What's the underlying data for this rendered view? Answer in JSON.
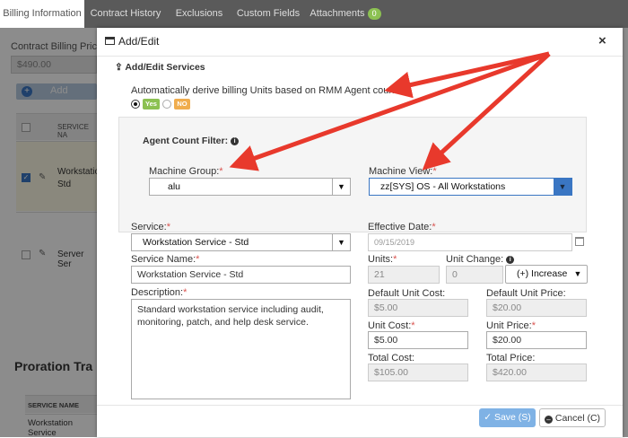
{
  "tabs": [
    {
      "label": "Billing Information"
    },
    {
      "label": "Contract History"
    },
    {
      "label": "Exclusions"
    },
    {
      "label": "Custom Fields"
    },
    {
      "label": "Attachments",
      "badge": "0"
    }
  ],
  "background": {
    "contract_billing_price_label": "Contract Billing Price:",
    "contract_billing_price_value": "$490.00",
    "add_label": "Add",
    "table_header": "SERVICE NA",
    "rows": [
      {
        "line1": "Workstatio",
        "line2": "Std",
        "checked": true
      },
      {
        "line1": "Server Ser",
        "line2": "",
        "checked": false
      }
    ],
    "proration_title": "Proration Tra",
    "proration_header": "SERVICE NAME",
    "proration_row": "Workstation Service"
  },
  "modal": {
    "title": "Add/Edit",
    "section_title": "Add/Edit Services",
    "auto_derive_label": "Automatically derive billing Units based on RMM Agent count:",
    "yes_label": "Yes",
    "no_label": "NO",
    "agent_filter_title": "Agent Count Filter:",
    "machine_group_label": "Machine Group:",
    "machine_group_value": "alu",
    "machine_view_label": "Machine View:",
    "machine_view_value": "zz[SYS] OS - All Workstations",
    "service_label": "Service:",
    "service_value": "Workstation Service - Std",
    "service_name_label": "Service Name:",
    "service_name_value": "Workstation Service - Std",
    "description_label": "Description:",
    "description_value": "Standard workstation service including audit, monitoring, patch, and help desk service.",
    "effective_date_label": "Effective Date:",
    "effective_date_value": "09/15/2019",
    "units_label": "Units:",
    "units_value": "21",
    "unit_change_label": "Unit Change:",
    "unit_change_value": "0",
    "unit_change_mode": "(+) Increase",
    "default_unit_cost_label": "Default Unit Cost:",
    "default_unit_cost_value": "$5.00",
    "default_unit_price_label": "Default Unit Price:",
    "default_unit_price_value": "$20.00",
    "unit_cost_label": "Unit Cost:",
    "unit_cost_value": "$5.00",
    "unit_price_label": "Unit Price:",
    "unit_price_value": "$20.00",
    "total_cost_label": "Total Cost:",
    "total_cost_value": "$105.00",
    "total_price_label": "Total Price:",
    "total_price_value": "$420.00",
    "save_label": "Save (S)",
    "cancel_label": "Cancel (C)"
  },
  "colors": {
    "annotation_arrow": "#e8392c",
    "accent_blue": "#3a76c3",
    "yes_green": "#8cc152",
    "no_orange": "#f0ad4e",
    "save_button": "#7fb2e5"
  }
}
